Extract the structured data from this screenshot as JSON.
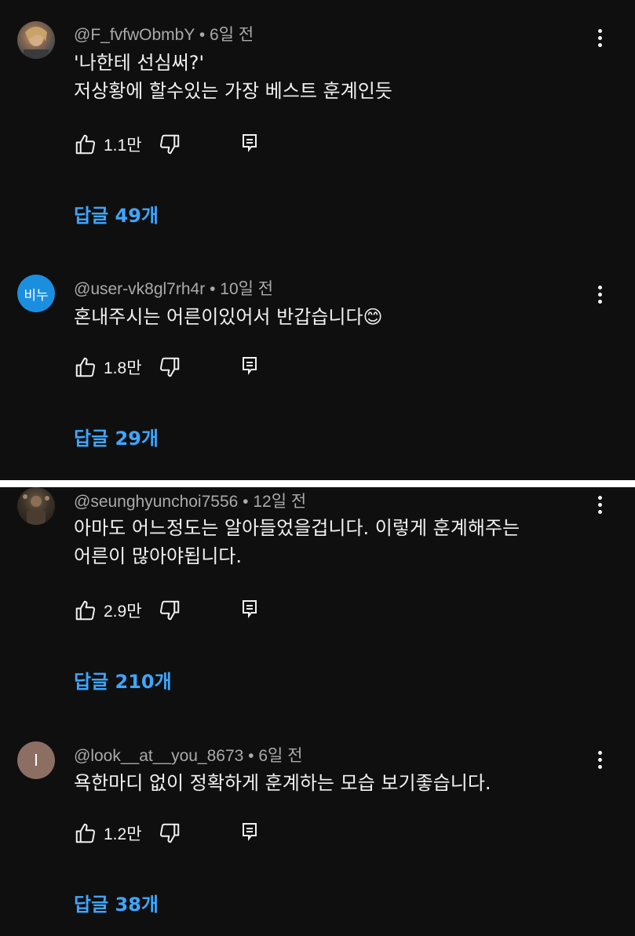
{
  "colors": {
    "background": "#0f0f0f",
    "meta": "#aaaaaa",
    "text": "#f1f1f1",
    "link": "#3ea6ff",
    "divider": "#ffffff"
  },
  "comments": [
    {
      "author": "@F_fvfwObmbY",
      "time": "6일 전",
      "avatar_text": "",
      "lines": [
        "'나한테 선심써?'",
        "저상황에 할수있는 가장 베스트 훈계인듯"
      ],
      "likes": "1.1만",
      "replies": "답글 49개"
    },
    {
      "author": "@user-vk8gl7rh4r",
      "time": "10일 전",
      "avatar_text": "비누",
      "lines": [
        "혼내주시는 어른이있어서 반갑습니다😊"
      ],
      "likes": "1.8만",
      "replies": "답글 29개"
    },
    {
      "author": "@seunghyunchoi7556",
      "time": "12일 전",
      "avatar_text": "",
      "lines": [
        "아마도 어느정도는 알아들었을겁니다. 이렇게 훈계해주는",
        "어른이 많아야됩니다."
      ],
      "likes": "2.9만",
      "replies": "답글 210개"
    },
    {
      "author": "@look__at__you_8673",
      "time": "6일 전",
      "avatar_text": "I",
      "lines": [
        "욕한마디 없이 정확하게 훈계하는 모습 보기좋습니다."
      ],
      "likes": "1.2만",
      "replies": "답글 38개"
    }
  ],
  "icons": {
    "like": "thumbs-up-icon",
    "dislike": "thumbs-down-icon",
    "reply": "reply-comment-icon",
    "menu": "more-vert-icon"
  },
  "separator": "•"
}
